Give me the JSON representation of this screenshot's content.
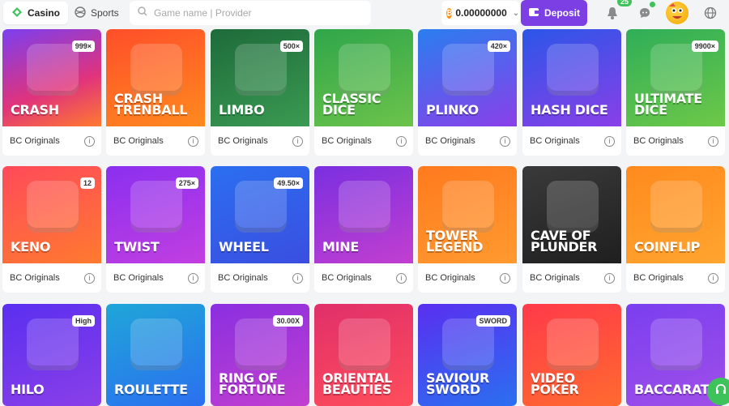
{
  "header": {
    "casino_label": "Casino",
    "sports_label": "Sports",
    "search_placeholder": "Game name | Provider",
    "balance": "0.00000000",
    "deposit_label": "Deposit",
    "notification_count": "25"
  },
  "games": [
    {
      "title": "CRASH",
      "provider": "BC Originals",
      "bg": "linear-gradient(160deg,#7b3ff0,#e0337c 60%,#ff7a2f)",
      "art": "999×"
    },
    {
      "title": "CRASH TRENBALL",
      "provider": "BC Originals",
      "bg": "linear-gradient(160deg,#ff4e2a,#ff8a1e)",
      "art": ""
    },
    {
      "title": "LIMBO",
      "provider": "BC Originals",
      "bg": "linear-gradient(160deg,#1e6b3a,#3a9a52)",
      "art": "500×"
    },
    {
      "title": "CLASSIC DICE",
      "provider": "BC Originals",
      "bg": "linear-gradient(160deg,#2fa64a,#6cc34b)",
      "art": ""
    },
    {
      "title": "PLINKO",
      "provider": "BC Originals",
      "bg": "linear-gradient(160deg,#2a7ef0,#8a3fe8)",
      "art": "420×"
    },
    {
      "title": "HASH DICE",
      "provider": "BC Originals",
      "bg": "linear-gradient(160deg,#2b56e8,#8a3fe8)",
      "art": ""
    },
    {
      "title": "ULTIMATE DICE",
      "provider": "BC Originals",
      "bg": "linear-gradient(160deg,#2fae58,#6dc848)",
      "art": "9900×"
    },
    {
      "title": "KENO",
      "provider": "BC Originals",
      "bg": "linear-gradient(160deg,#ff4a5a,#ff7a2f)",
      "art": "12"
    },
    {
      "title": "TWIST",
      "provider": "BC Originals",
      "bg": "linear-gradient(160deg,#8a2ff0,#c23fe0)",
      "art": "275×"
    },
    {
      "title": "WHEEL",
      "provider": "BC Originals",
      "bg": "linear-gradient(160deg,#2b6ff0,#3a4ee0)",
      "art": "49.50×"
    },
    {
      "title": "MINE",
      "provider": "BC Originals",
      "bg": "linear-gradient(160deg,#7a2fe0,#c23fd0)",
      "art": ""
    },
    {
      "title": "TOWER LEGEND",
      "provider": "BC Originals",
      "bg": "linear-gradient(160deg,#ff7a1e,#ff9a2f)",
      "art": ""
    },
    {
      "title": "CAVE OF PLUNDER",
      "provider": "BC Originals",
      "bg": "linear-gradient(160deg,#3a3a3a,#1f1f1f)",
      "art": ""
    },
    {
      "title": "COINFLIP",
      "provider": "BC Originals",
      "bg": "linear-gradient(160deg,#ff8a1e,#ffa52f)",
      "art": ""
    },
    {
      "title": "HILO",
      "provider": "",
      "bg": "linear-gradient(160deg,#5a2ff0,#8a3fe8)",
      "art": "High"
    },
    {
      "title": "ROULETTE",
      "provider": "",
      "bg": "linear-gradient(160deg,#1fa6d8,#2b6ff0)",
      "art": ""
    },
    {
      "title": "RING OF FORTUNE",
      "provider": "",
      "bg": "linear-gradient(160deg,#8a2fe0,#c23fd0)",
      "art": "30.00X"
    },
    {
      "title": "ORIENTAL BEAUTIES",
      "provider": "",
      "bg": "linear-gradient(160deg,#e02f6a,#ff4e5a)",
      "art": ""
    },
    {
      "title": "SAVIOUR SWORD",
      "provider": "",
      "bg": "linear-gradient(160deg,#5a2ff0,#2b6ff0)",
      "art": "SWORD"
    },
    {
      "title": "VIDEO POKER",
      "provider": "",
      "bg": "linear-gradient(160deg,#ff3a4a,#ff6a2f)",
      "art": ""
    },
    {
      "title": "BACCARAT",
      "provider": "",
      "bg": "linear-gradient(160deg,#7a3ff0,#a04fe8)",
      "art": ""
    }
  ]
}
